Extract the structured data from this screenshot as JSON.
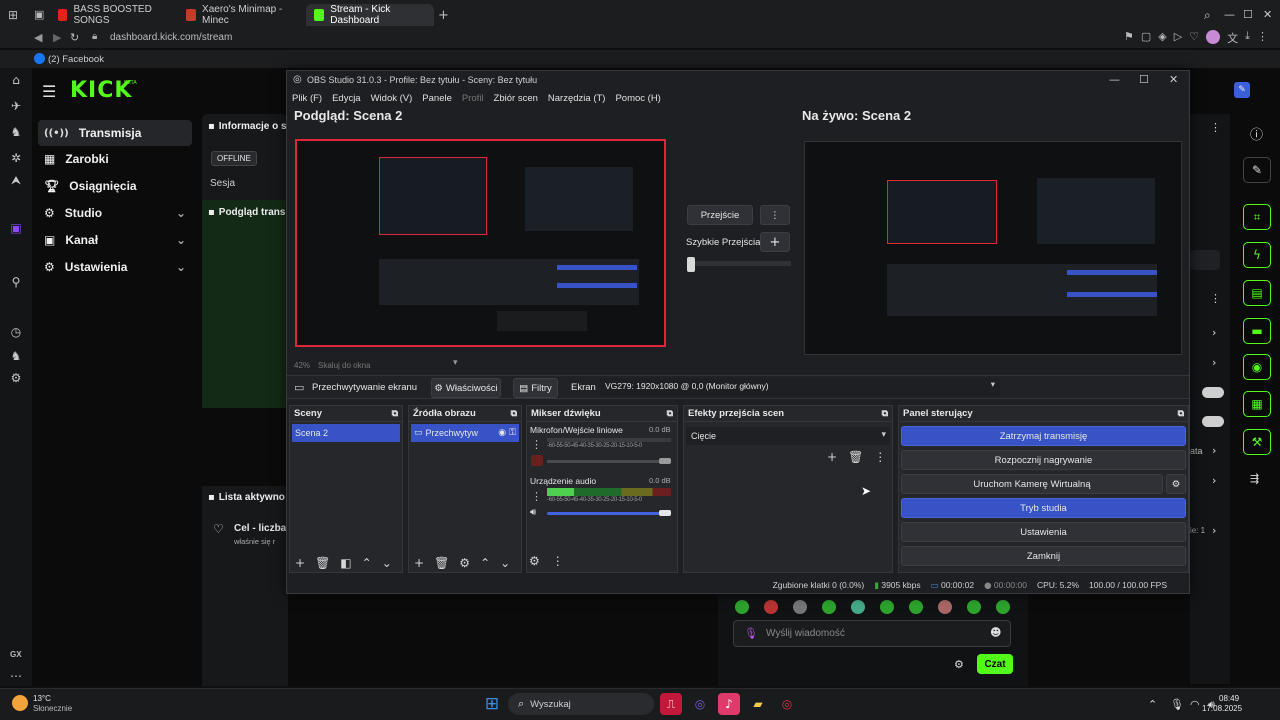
{
  "browser": {
    "tabs": [
      {
        "label": "BASS BOOSTED SONGS",
        "color": "#e62117"
      },
      {
        "label": "Xaero's Minimap - Minec",
        "color": "#c53b27"
      },
      {
        "label": "Stream - Kick Dashboard",
        "color": "#53fc18",
        "active": true
      }
    ],
    "url": "dashboard.kick.com/stream",
    "bookmark": "(2) Facebook"
  },
  "kick": {
    "logo": "KICK",
    "logo_sup": "BETA",
    "nav": [
      {
        "label": "Transmisja",
        "icon": "broadcast-icon",
        "active": true
      },
      {
        "label": "Zarobki",
        "icon": "earnings-icon"
      },
      {
        "label": "Osiągnięcia",
        "icon": "trophy-icon"
      },
      {
        "label": "Studio",
        "icon": "studio-icon",
        "chevron": true
      },
      {
        "label": "Kanał",
        "icon": "channel-icon",
        "chevron": true
      },
      {
        "label": "Ustawienia",
        "icon": "settings-icon",
        "chevron": true
      }
    ],
    "info_title": "Informacje o s",
    "offline_badge": "OFFLINE",
    "session": "Sesja",
    "preview_title": "Podgląd transı",
    "active_list": "Lista aktywno",
    "goal_title": "Cel - liczba",
    "goal_sub": "właśnie się r",
    "ata": "ata",
    "ie1": "ie: 1",
    "chat_placeholder": "Wyślij wiadomość",
    "chat_button": "Czat",
    "gx": "GX",
    "accent": "#53fc18"
  },
  "obs": {
    "title": "OBS Studio 31.0.3 - Profile: Bez tytułu - Sceny: Bez tytułu",
    "menu": [
      "Plik (F)",
      "Edycja",
      "Widok (V)",
      "Panele",
      "Profil",
      "Zbiór scen",
      "Narzędzia (T)",
      "Pomoc (H)"
    ],
    "preview_label": "Podgląd: Scena 2",
    "live_label": "Na żywo: Scena 2",
    "transition_btn": "Przejście",
    "quick_transitions": "Szybkie Przejścia",
    "zoom": "42%",
    "scale_label": "Skaluj do okna",
    "source_bar": {
      "capture": "Przechwytywanie ekranu",
      "properties": "Właściwości",
      "filters": "Filtry",
      "screen_label": "Ekran",
      "screen_value": "VG279: 1920x1080 @ 0,0 (Monitor główny)"
    },
    "panels": {
      "scenes": {
        "title": "Sceny",
        "items": [
          "Scena 2"
        ]
      },
      "sources": {
        "title": "Źródła obrazu",
        "items": [
          "Przechwytyw"
        ]
      },
      "mixer": {
        "title": "Mikser dźwięku",
        "channels": [
          {
            "name": "Mikrofon/Wejście liniowe",
            "db": "0.0 dB",
            "level": 0,
            "muted": true
          },
          {
            "name": "Urządzenie audio",
            "db": "0.0 dB",
            "level": 0.22,
            "muted": false
          }
        ],
        "ticks": "-60-55-50-45-40-35-30-25-20-15-10-5-0"
      },
      "transitions": {
        "title": "Efekty przejścia scen",
        "selected": "Cięcie"
      },
      "controls": {
        "title": "Panel sterujący",
        "buttons": [
          "Zatrzymaj transmisję",
          "Rozpocznij nagrywanie",
          "Uruchom Kamerę Wirtualną",
          "Tryb studia",
          "Ustawienia",
          "Zamknij"
        ]
      }
    },
    "status": {
      "dropped": "Zgubione klatki 0 (0.0%)",
      "kbps": "3905 kbps",
      "live_time": "00:00:02",
      "rec_time": "00:00:00",
      "cpu": "CPU: 5.2%",
      "fps": "100.00 / 100.00 FPS"
    }
  },
  "taskbar": {
    "weather_temp": "13°C",
    "weather_desc": "Słonecznie",
    "search": "Wyszukaj",
    "time": "08:49",
    "date": "17.08.2025"
  }
}
